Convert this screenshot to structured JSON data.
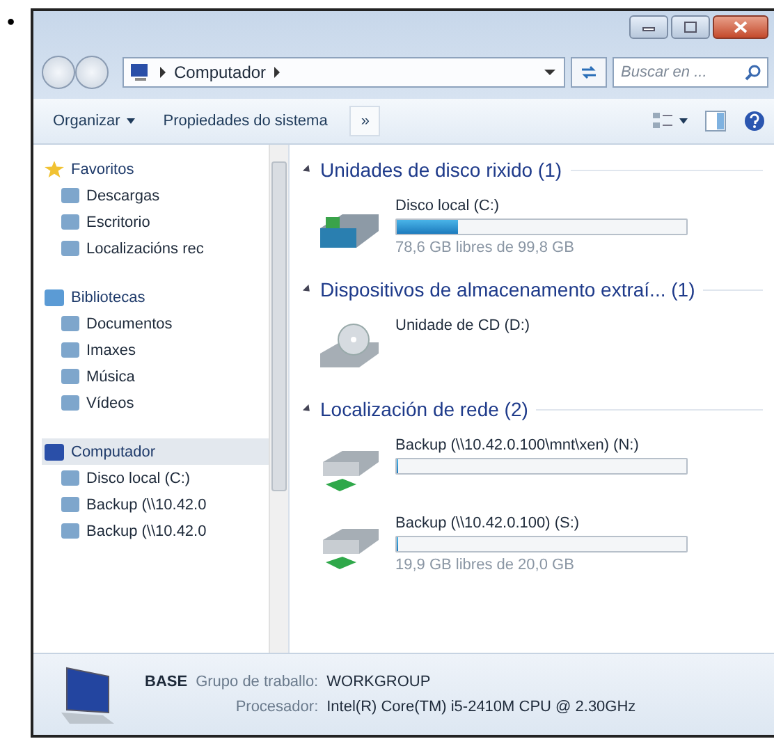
{
  "bullet": "•",
  "address": {
    "crumbs": [
      "Computador"
    ],
    "search_placeholder": "Buscar en ..."
  },
  "toolbar": {
    "organize": "Organizar",
    "system_properties": "Propiedades do sistema",
    "more": "»"
  },
  "sidebar": {
    "groups": [
      {
        "label": "Favoritos",
        "selected": false,
        "children": [
          {
            "label": "Descargas"
          },
          {
            "label": "Escritorio"
          },
          {
            "label": "Localizacións rec"
          }
        ]
      },
      {
        "label": "Bibliotecas",
        "selected": false,
        "children": [
          {
            "label": "Documentos"
          },
          {
            "label": "Imaxes"
          },
          {
            "label": "Música"
          },
          {
            "label": "Vídeos"
          }
        ]
      },
      {
        "label": "Computador",
        "selected": true,
        "children": [
          {
            "label": "Disco local (C:)"
          },
          {
            "label": "Backup (\\\\10.42.0"
          },
          {
            "label": "Backup (\\\\10.42.0"
          }
        ]
      }
    ]
  },
  "sections": [
    {
      "title": "Unidades de disco rixido (1)",
      "items": [
        {
          "kind": "hdd",
          "name": "Disco local (C:)",
          "level": 0.21,
          "free": "78,6 GB libres de 99,8 GB"
        }
      ]
    },
    {
      "title": "Dispositivos de almacenamento extraí... (1)",
      "items": [
        {
          "kind": "cd",
          "name": "Unidade de CD (D:)"
        }
      ]
    },
    {
      "title": "Localización de rede (2)",
      "items": [
        {
          "kind": "network",
          "name": "Backup (\\\\10.42.0.100\\mnt\\xen) (N:)",
          "level": 0
        },
        {
          "kind": "network",
          "name": "Backup (\\\\10.42.0.100) (S:)",
          "level": 0.005,
          "free": "19,9 GB libres de 20,0 GB"
        }
      ]
    }
  ],
  "details": {
    "name": "BASE",
    "workgroup_label": "Grupo de traballo:",
    "workgroup": "WORKGROUP",
    "cpu_label": "Procesador:",
    "cpu": "Intel(R) Core(TM) i5-2410M CPU @ 2.30GHz"
  }
}
